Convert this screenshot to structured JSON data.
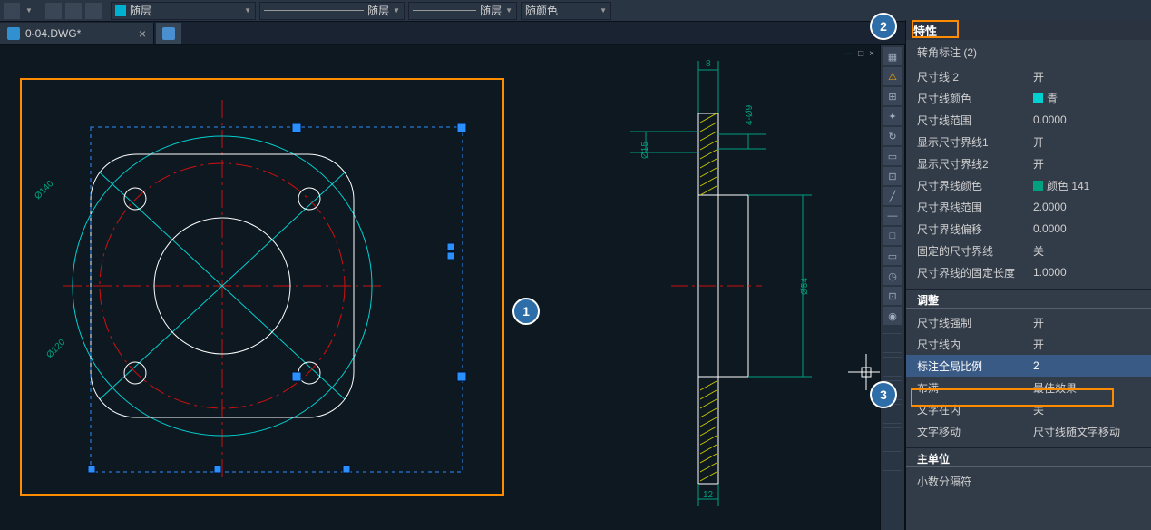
{
  "toolbar": {
    "dropdowns": [
      {
        "swatch": "#00b0d0",
        "label": "随层"
      },
      {
        "swatch": null,
        "label": "随层"
      },
      {
        "swatch": null,
        "label": "随层"
      },
      {
        "swatch": null,
        "label": "随颜色"
      }
    ]
  },
  "file_tab": {
    "name": "0-04.DWG*",
    "close": "×"
  },
  "window_controls": {
    "minimize": "—",
    "restore": "□",
    "close": "×"
  },
  "drawing": {
    "dim_phi140": "Ø140",
    "dim_phi120": "Ø120",
    "dim_8": "8",
    "dim_4phi9": "4-Ø9",
    "dim_phi15": "Ø15",
    "dim_12": "12",
    "dim_phi54": "Ø54"
  },
  "right_toolbar": {
    "icons_upper": [
      "▦",
      "⚠",
      "⊞",
      "✦",
      "↻",
      "▭",
      "⊡",
      "╱",
      "—",
      "□",
      "▭",
      "◷",
      "⊡",
      "◉"
    ]
  },
  "annotations": {
    "one": "1",
    "two": "2",
    "three": "3"
  },
  "properties": {
    "title": "特性",
    "selection": "转角标注 (2)",
    "rows_1": [
      {
        "k": "尺寸线 2",
        "v": "开"
      },
      {
        "k": "尺寸线颜色",
        "v": "青",
        "swatch": "cyan"
      },
      {
        "k": "尺寸线范围",
        "v": "0.0000"
      },
      {
        "k": "显示尺寸界线1",
        "v": "开"
      },
      {
        "k": "显示尺寸界线2",
        "v": "开"
      },
      {
        "k": "尺寸界线颜色",
        "v": "颜色 141",
        "swatch": "141"
      },
      {
        "k": "尺寸界线范围",
        "v": "2.0000"
      },
      {
        "k": "尺寸界线偏移",
        "v": "0.0000"
      },
      {
        "k": "固定的尺寸界线",
        "v": "关"
      },
      {
        "k": "尺寸界线的固定长度",
        "v": "1.0000"
      }
    ],
    "section_adjust": "调整",
    "rows_2": [
      {
        "k": "尺寸线强制",
        "v": "开"
      },
      {
        "k": "尺寸线内",
        "v": "开"
      },
      {
        "k": "标注全局比例",
        "v": "2",
        "selected": true
      },
      {
        "k": "布满",
        "v": "最佳效果"
      },
      {
        "k": "文字在内",
        "v": "关"
      },
      {
        "k": "文字移动",
        "v": "尺寸线随文字移动"
      }
    ],
    "section_units": "主单位",
    "rows_3": [
      {
        "k": "小数分隔符",
        "v": ""
      }
    ]
  }
}
